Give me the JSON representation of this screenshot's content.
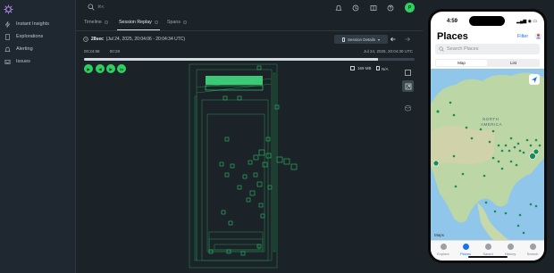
{
  "sidebar": {
    "items": [
      {
        "label": "Instant Insights",
        "icon": "lightning-icon"
      },
      {
        "label": "Explorations",
        "icon": "document-icon"
      },
      {
        "label": "Alerting",
        "icon": "bell-icon"
      },
      {
        "label": "Issues",
        "icon": "inbox-icon"
      }
    ]
  },
  "topbar": {
    "search_shortcut": "⌘K",
    "avatar_initial": "P"
  },
  "tabs": [
    {
      "label": "Timeline"
    },
    {
      "label": "Session Replay"
    },
    {
      "label": "Spans"
    }
  ],
  "session": {
    "duration": "28sec",
    "range": "(Jul 24, 2025, 20:04:06 - 20:04:34 UTC)",
    "details_button": "Session Details"
  },
  "player": {
    "current_time": "00:24:88",
    "total_time": "00:28",
    "timestamp": "Jul 24, 2025, 20:04:30 UTC",
    "progress": 0.89,
    "speed": "1x",
    "memory": "169 MB",
    "network": "N/A"
  },
  "phone": {
    "time": "4:59",
    "status_icons": "▂▄▆ ◉ ▭",
    "title": "Places",
    "filter": "Filter",
    "search_placeholder": "Search Places",
    "segments": [
      "Map",
      "List"
    ],
    "map_label_line1": "NORTH",
    "map_label_line2": "AMERICA",
    "maps_credit": " Maps",
    "tabs": [
      "Explore",
      "Places",
      "Saved",
      "History",
      "Search"
    ],
    "active_tab": "Places"
  },
  "colors": {
    "accent": "#2fcf61",
    "background": "#1b2329",
    "link": "#1a73e8"
  }
}
